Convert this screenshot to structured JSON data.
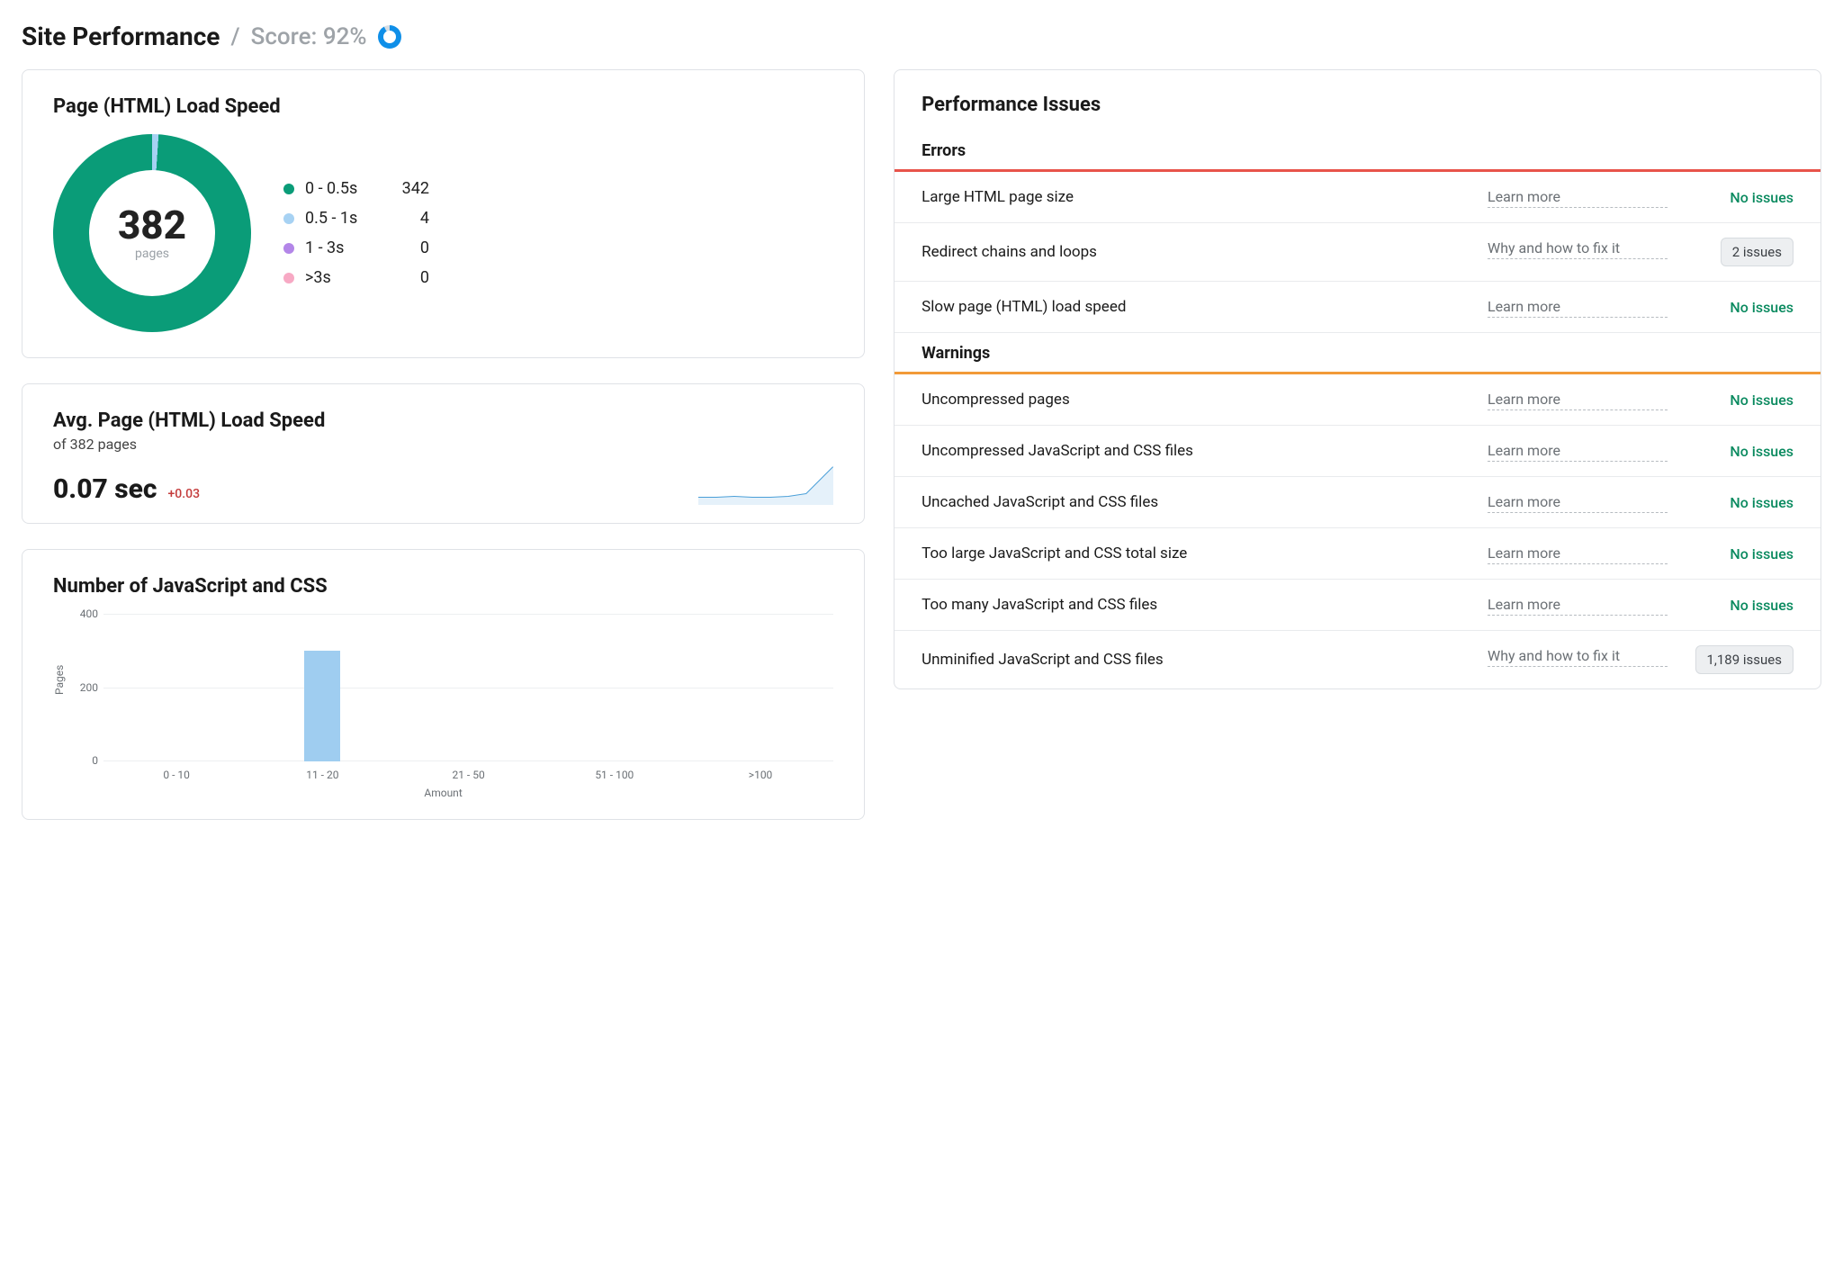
{
  "header": {
    "title": "Site Performance",
    "score_prefix": "/",
    "score_text": "Score: 92%"
  },
  "colors": {
    "teal": "#0a9c78",
    "lightblue": "#a7d2f3",
    "purple": "#b386e8",
    "pink": "#f7a9c4",
    "barblue": "#9fcdf0",
    "error": "#e8534a",
    "warning": "#f29a38",
    "good": "#0a8a5f"
  },
  "donut": {
    "title": "Page (HTML) Load Speed",
    "center_value": "382",
    "center_label": "pages",
    "legend": [
      {
        "label": "0 - 0.5s",
        "value": "342",
        "color_key": "teal"
      },
      {
        "label": "0.5 - 1s",
        "value": "4",
        "color_key": "lightblue"
      },
      {
        "label": "1 - 3s",
        "value": "0",
        "color_key": "purple"
      },
      {
        "label": ">3s",
        "value": "0",
        "color_key": "pink"
      }
    ]
  },
  "avg_speed": {
    "title": "Avg. Page (HTML) Load Speed",
    "sub": "of 382 pages",
    "value": "0.07 sec",
    "delta": "+0.03"
  },
  "bar_chart": {
    "title": "Number of JavaScript and CSS",
    "ylabel": "Pages",
    "xlabel": "Amount",
    "yticks": [
      "400",
      "200",
      "0"
    ],
    "categories": [
      "0 - 10",
      "11 - 20",
      "21 - 50",
      "51 - 100",
      ">100"
    ]
  },
  "chart_data": [
    {
      "type": "donut",
      "title": "Page (HTML) Load Speed",
      "total": 382,
      "unit": "pages",
      "series": [
        {
          "name": "0 - 0.5s",
          "value": 342
        },
        {
          "name": "0.5 - 1s",
          "value": 4
        },
        {
          "name": "1 - 3s",
          "value": 0
        },
        {
          "name": ">3s",
          "value": 0
        }
      ]
    },
    {
      "type": "line",
      "title": "Avg. Page (HTML) Load Speed sparkline",
      "ylabel": "sec",
      "x": [
        1,
        2,
        3,
        4,
        5,
        6,
        7,
        8
      ],
      "values": [
        0.04,
        0.04,
        0.04,
        0.04,
        0.04,
        0.04,
        0.05,
        0.1
      ]
    },
    {
      "type": "bar",
      "title": "Number of JavaScript and CSS",
      "xlabel": "Amount",
      "ylabel": "Pages",
      "ylim": [
        0,
        400
      ],
      "categories": [
        "0 - 10",
        "11 - 20",
        "21 - 50",
        "51 - 100",
        ">100"
      ],
      "values": [
        0,
        300,
        0,
        0,
        0
      ]
    }
  ],
  "issues": {
    "title": "Performance Issues",
    "sections": [
      {
        "name": "Errors",
        "type": "errors",
        "rows": [
          {
            "name": "Large HTML page size",
            "link": "Learn more",
            "status_text": "No issues",
            "has_issue": false
          },
          {
            "name": "Redirect chains and loops",
            "link": "Why and how to fix it",
            "status_text": "2 issues",
            "has_issue": true
          },
          {
            "name": "Slow page (HTML) load speed",
            "link": "Learn more",
            "status_text": "No issues",
            "has_issue": false
          }
        ]
      },
      {
        "name": "Warnings",
        "type": "warnings",
        "rows": [
          {
            "name": "Uncompressed pages",
            "link": "Learn more",
            "status_text": "No issues",
            "has_issue": false
          },
          {
            "name": "Uncompressed JavaScript and CSS files",
            "link": "Learn more",
            "status_text": "No issues",
            "has_issue": false
          },
          {
            "name": "Uncached JavaScript and CSS files",
            "link": "Learn more",
            "status_text": "No issues",
            "has_issue": false
          },
          {
            "name": "Too large JavaScript and CSS total size",
            "link": "Learn more",
            "status_text": "No issues",
            "has_issue": false
          },
          {
            "name": "Too many JavaScript and CSS files",
            "link": "Learn more",
            "status_text": "No issues",
            "has_issue": false
          },
          {
            "name": "Unminified JavaScript and CSS files",
            "link": "Why and how to fix it",
            "status_text": "1,189 issues",
            "has_issue": true
          }
        ]
      }
    ]
  }
}
